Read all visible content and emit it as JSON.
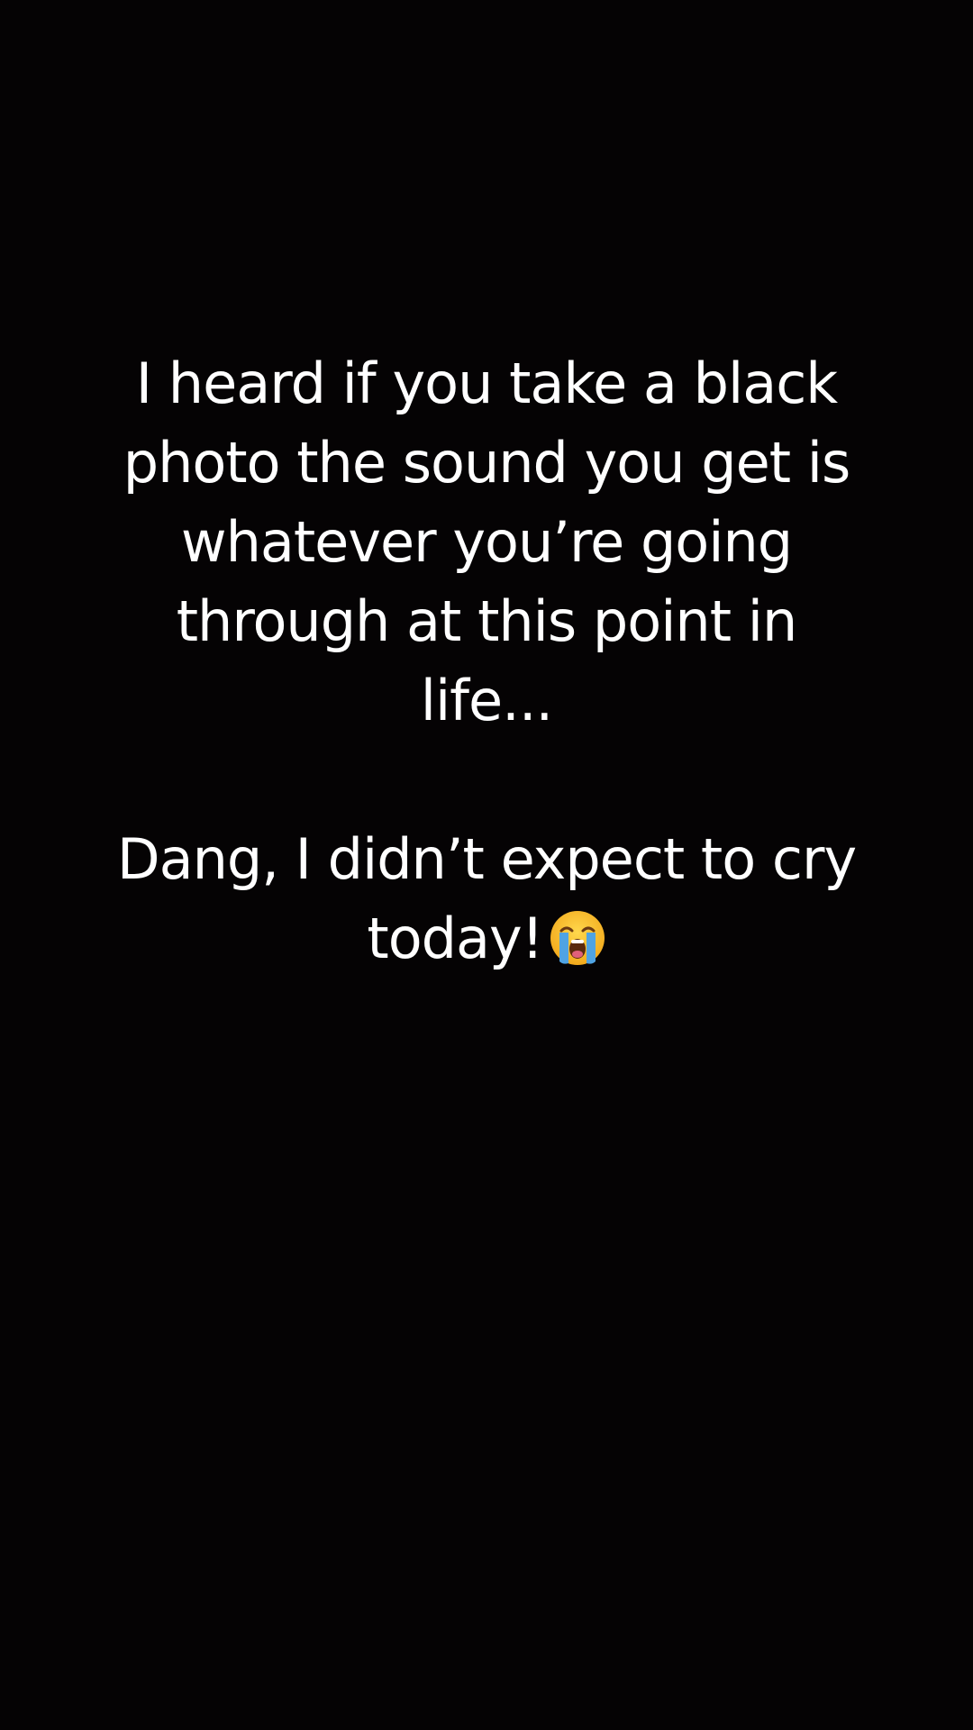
{
  "caption": {
    "line1": "I heard if you take a black",
    "line2": "photo the sound you get is",
    "line3": "whatever you’re going",
    "line4": "through at this point in",
    "line5": "life...",
    "line6": "Dang, I didn’t expect to cry",
    "line7": "today!",
    "emoji_icon": "loudly-crying-face-icon"
  },
  "colors": {
    "background": "#050304",
    "text": "#ffffff",
    "emoji_face": "#f7c234",
    "emoji_tears": "#4fa3e3"
  }
}
